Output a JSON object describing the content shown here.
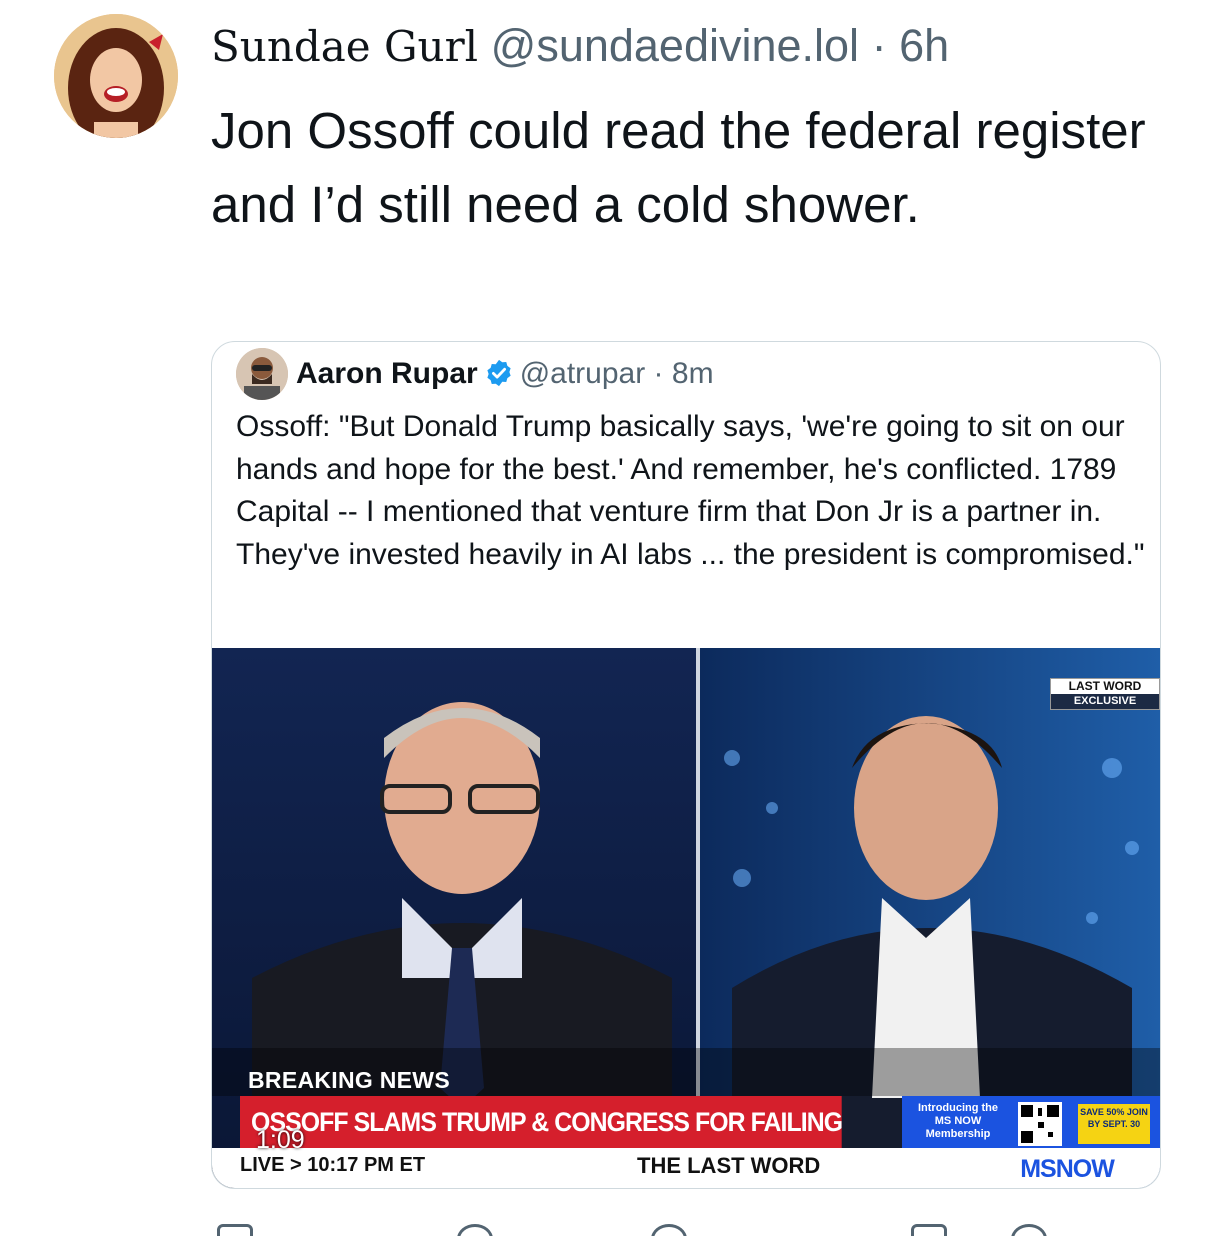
{
  "post": {
    "author_name": "Sundae Gurl",
    "handle": "@sundaedivine.lol",
    "separator": "·",
    "time": "6h",
    "text": "Jon Ossoff could read the federal register and I’d still need a cold shower."
  },
  "quoted_post": {
    "author_name": "Aaron Rupar",
    "verified": true,
    "handle": "@atrupar",
    "separator": "·",
    "time": "8m",
    "text": "Ossoff: \"But Donald Trump basically says, 'we're going to sit on our hands and hope for the best.' And remember, he's conflicted. 1789 Capital -- I mentioned that venture firm that Don Jr is a partner in. They've invested heavily in AI labs ... the president is compromised.\""
  },
  "video": {
    "duration": "1:09",
    "breaking_label": "BREAKING NEWS",
    "headline": "OSSOFF SLAMS TRUMP & CONGRESS FOR FAILING TO REGULATE AI",
    "live_strip": "LIVE > 10:17 PM ET",
    "show_name": "THE LAST WORD",
    "network": "MSNOW",
    "promo_intro": "Introducing the MS NOW Membership",
    "promo_save": "SAVE 50% JOIN BY SEPT. 30",
    "corner_tag_top": "LAST WORD",
    "corner_tag_bottom": "EXCLUSIVE"
  },
  "colors": {
    "text_primary": "#0f1419",
    "text_secondary": "#536471",
    "verified_blue": "#1d9bf0",
    "border": "#cfd9de",
    "chyron_red": "#d51f2c",
    "network_blue": "#1b53e0"
  },
  "icons": {
    "verified": "verified-badge-icon",
    "reply": "reply-icon",
    "repost": "repost-icon",
    "like": "heart-icon",
    "bookmark": "bookmark-icon",
    "share": "share-icon"
  }
}
